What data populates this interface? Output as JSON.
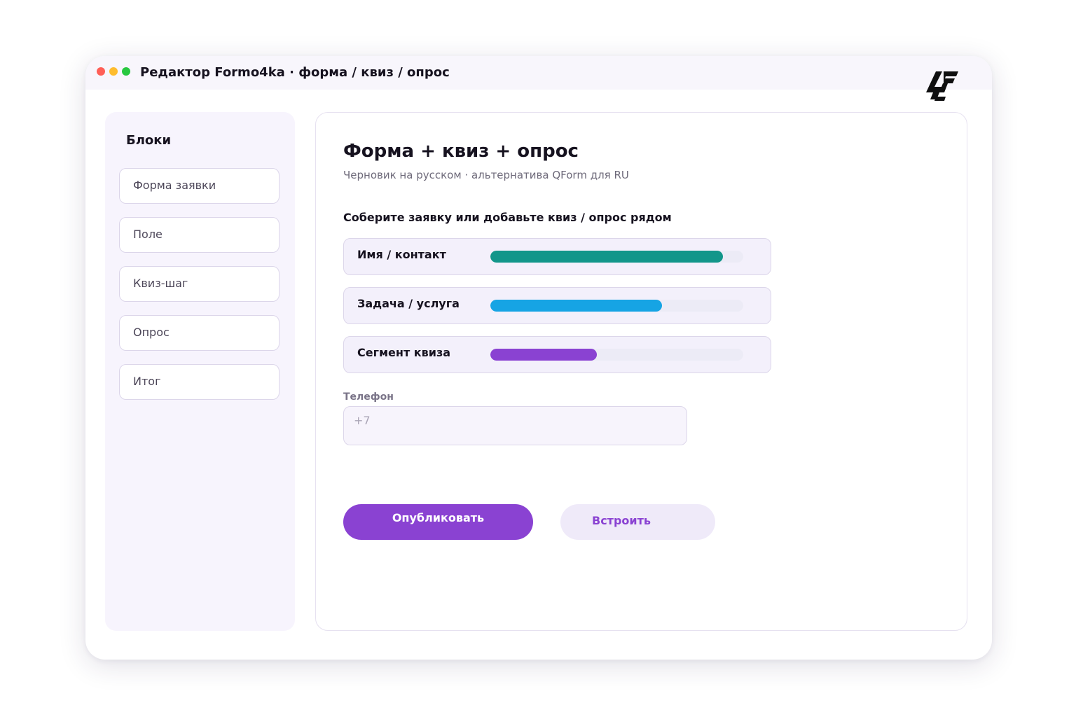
{
  "window": {
    "title": "Редактор Formo4ka · форма / квиз / опрос"
  },
  "sidebar": {
    "title": "Блоки",
    "items": [
      {
        "label": "Форма заявки"
      },
      {
        "label": "Поле"
      },
      {
        "label": "Квиз-шаг"
      },
      {
        "label": "Опрос"
      },
      {
        "label": "Итог"
      }
    ]
  },
  "main": {
    "title": "Форма + квиз + опрос",
    "subtitle": "Черновик на русском · альтернатива QForm для RU",
    "section_heading": "Соберите заявку или добавьте квиз / опрос рядом",
    "segments": [
      {
        "label": "Имя / контакт",
        "progress": 0.92,
        "color": "#12968a"
      },
      {
        "label": "Задача / услуга",
        "progress": 0.68,
        "color": "#16a4e4"
      },
      {
        "label": "Сегмент квиза",
        "progress": 0.42,
        "color": "#8a42d2"
      }
    ],
    "phone_field": {
      "label": "Телефон",
      "placeholder": "+7",
      "value": ""
    },
    "publish_label": "Опубликовать",
    "embed_label": "Встроить"
  },
  "colors": {
    "accent": "#8a42d2",
    "accent_soft": "#efeaf9",
    "panel_bg": "#f7f4fd",
    "border": "#dcd6ea"
  },
  "icons": {
    "logo": "formo4ka-logo"
  }
}
